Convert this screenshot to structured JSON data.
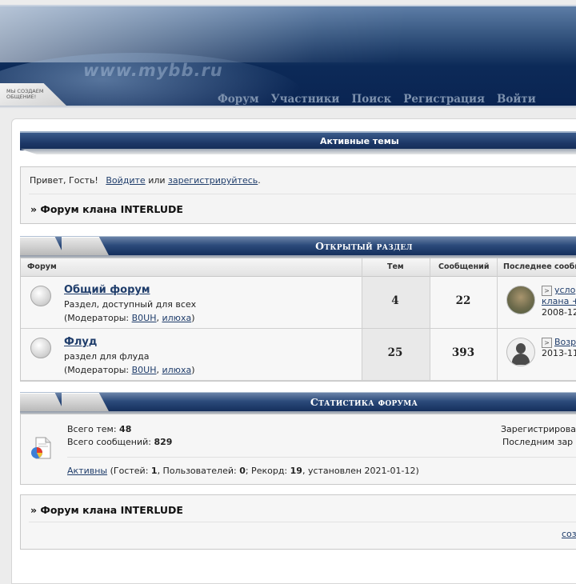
{
  "header": {
    "logo_text": "www.mybb.ru",
    "slogan": "мы создаем общение!",
    "nav": [
      "Форум",
      "Участники",
      "Поиск",
      "Регистрация",
      "Войти"
    ]
  },
  "active_topics": "Активные темы",
  "greeting": {
    "hello": "Привет, Гость!",
    "login": "Войдите",
    "or": "или",
    "register": "зарегистрируйтесь",
    "dot": ".",
    "crumb": "» Форум клана INTERLUDE"
  },
  "category": {
    "title": "Открытый раздел",
    "columns": [
      "Форум",
      "Тем",
      "Сообщений",
      "Последнее сообщ"
    ],
    "forums": [
      {
        "name": "Общий форум",
        "description": "Раздел, доступный для всех",
        "mods_prefix": "(Модераторы: ",
        "mod1": "B0UH",
        "comma": ", ",
        "mod2": "илюха",
        "mods_suffix": ")",
        "topics": "4",
        "posts": "22",
        "last_line1": "усло",
        "last_line2": "клана +",
        "last_date": "2008-12"
      },
      {
        "name": "Флуд",
        "description": "раздел для флуда",
        "mods_prefix": "(Модераторы: ",
        "mod1": "B0UH",
        "comma": ", ",
        "mod2": "илюха",
        "mods_suffix": ")",
        "topics": "25",
        "posts": "393",
        "last_line1": "Возр",
        "last_date": "2013-11"
      }
    ]
  },
  "stats": {
    "title": "Статистика форума",
    "topics_label": "Всего тем: ",
    "topics_value": "48",
    "posts_label": "Всего сообщений: ",
    "posts_value": "829",
    "registered": "Зарегистрирова",
    "last_registered": "Последним зар",
    "online_link": "Активны",
    "online_a": " (Гостей: ",
    "guests": "1",
    "online_b": ", Пользователей: ",
    "users": "0",
    "online_c": "; Рекорд: ",
    "record": "19",
    "online_d": ", установлен 2021-01-12)"
  },
  "footer": {
    "crumb": "» Форум клана INTERLUDE",
    "link": "соз"
  }
}
